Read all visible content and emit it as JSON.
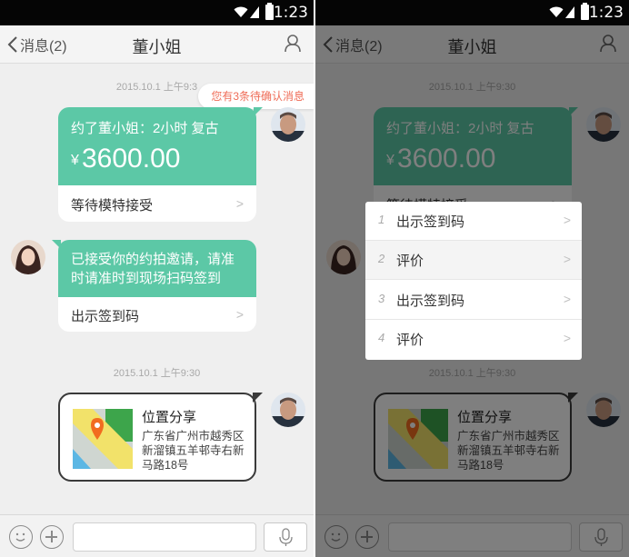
{
  "status_bar": {
    "time": "1:23"
  },
  "nav": {
    "back_label": "消息(2)",
    "title": "董小姐"
  },
  "toast": "您有3条待确认消息",
  "messages": {
    "timestamp_1": "2015.10.1  上午9:30",
    "timestamp_1_partial": "2015.10.1  上午9:3",
    "order_card": {
      "headline": "约了董小姐：2小时 复古",
      "currency": "¥",
      "amount": "3600.00",
      "action": "等待模特接受"
    },
    "invite_card": {
      "text": "已接受你的约拍邀请，请准时请准时到现场扫码签到",
      "action": "出示签到码"
    },
    "timestamp_2": "2015.10.1  上午9:30",
    "location_card": {
      "title": "位置分享",
      "address": "广东省广州市越秀区新溜镇五羊邨寺右新马路18号"
    }
  },
  "popup_menu": {
    "items": [
      {
        "index": "1",
        "label": "出示签到码"
      },
      {
        "index": "2",
        "label": "评价"
      },
      {
        "index": "3",
        "label": "出示签到码"
      },
      {
        "index": "4",
        "label": "评价"
      }
    ]
  },
  "colors": {
    "accent_green": "#5cc8a6",
    "toast_text": "#ef6c57",
    "background": "#efefef"
  },
  "icons": [
    "back-chevron-icon",
    "profile-icon",
    "wifi-icon",
    "signal-icon",
    "battery-icon",
    "emoji-icon",
    "plus-icon",
    "microphone-icon",
    "map-pin-icon",
    "chevron-right-icon"
  ]
}
